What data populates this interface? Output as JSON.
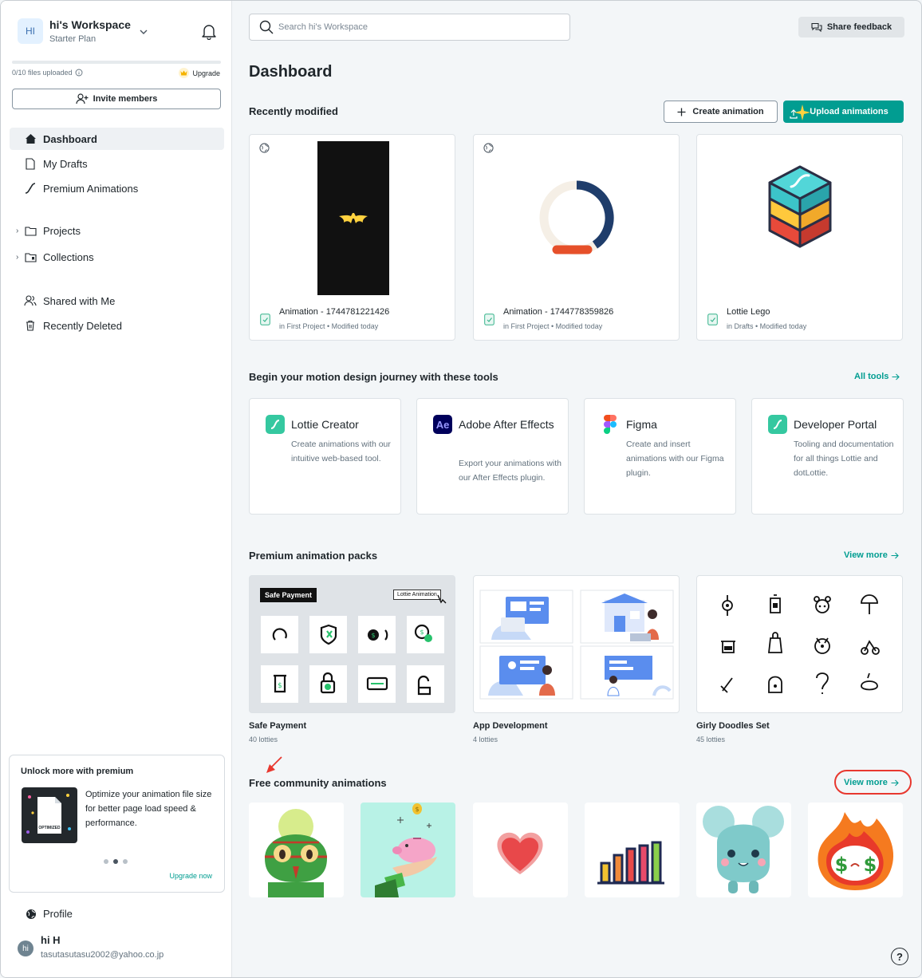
{
  "workspace": {
    "avatar": "HI",
    "name": "hi's Workspace",
    "plan": "Starter Plan",
    "usage_text": "0/10 files uploaded",
    "usage_fraction": 0,
    "upgrade_label": "Upgrade",
    "invite_label": "Invite members"
  },
  "nav": {
    "dashboard": "Dashboard",
    "drafts": "My Drafts",
    "premium": "Premium Animations",
    "projects": "Projects",
    "collections": "Collections",
    "shared": "Shared with Me",
    "deleted": "Recently Deleted"
  },
  "promo": {
    "title": "Unlock more with premium",
    "text": "Optimize your animation file size for better page load speed & performance.",
    "image_label": "OPTIMIZED",
    "link": "Upgrade now"
  },
  "profile": {
    "label": "Profile",
    "avatar": "hi",
    "name": "hi H",
    "email": "tasutasutasu2002@yahoo.co.jp"
  },
  "header": {
    "search_placeholder": "Search hi's Workspace",
    "feedback_label": "Share feedback",
    "title": "Dashboard"
  },
  "recent": {
    "title": "Recently modified",
    "create_label": "Create animation",
    "upload_label": "Upload animations",
    "items": [
      {
        "name": "Animation - 1744781221426",
        "meta": "in First Project • Modified today"
      },
      {
        "name": "Animation - 1744778359826",
        "meta": "in First Project • Modified today"
      },
      {
        "name": "Lottie Lego",
        "meta": "in Drafts • Modified today"
      }
    ]
  },
  "tools": {
    "title": "Begin your motion design journey with these tools",
    "all_label": "All tools",
    "items": [
      {
        "name": "Lottie Creator",
        "desc": "Create animations with our intuitive web-based tool."
      },
      {
        "name": "Adobe After Effects",
        "desc": "Export your animations with our After Effects plugin.",
        "icon_text": "Ae"
      },
      {
        "name": "Figma",
        "desc": "Create and insert animations with our Figma plugin."
      },
      {
        "name": "Developer Portal",
        "desc": "Tooling and documentation for all things Lottie and dotLottie."
      }
    ]
  },
  "packs": {
    "title": "Premium animation packs",
    "more_label": "View more",
    "safe_payment_tag": "Safe Payment",
    "lottie_animation_tag": "Lottie Animation",
    "items": [
      {
        "name": "Safe Payment",
        "count": "40 lotties"
      },
      {
        "name": "App Development",
        "count": "4 lotties"
      },
      {
        "name": "Girly Doodles Set",
        "count": "45 lotties"
      }
    ]
  },
  "community": {
    "title": "Free community animations",
    "more_label": "View more"
  },
  "colors": {
    "accent": "#019d91",
    "annotation": "#e8382f"
  }
}
